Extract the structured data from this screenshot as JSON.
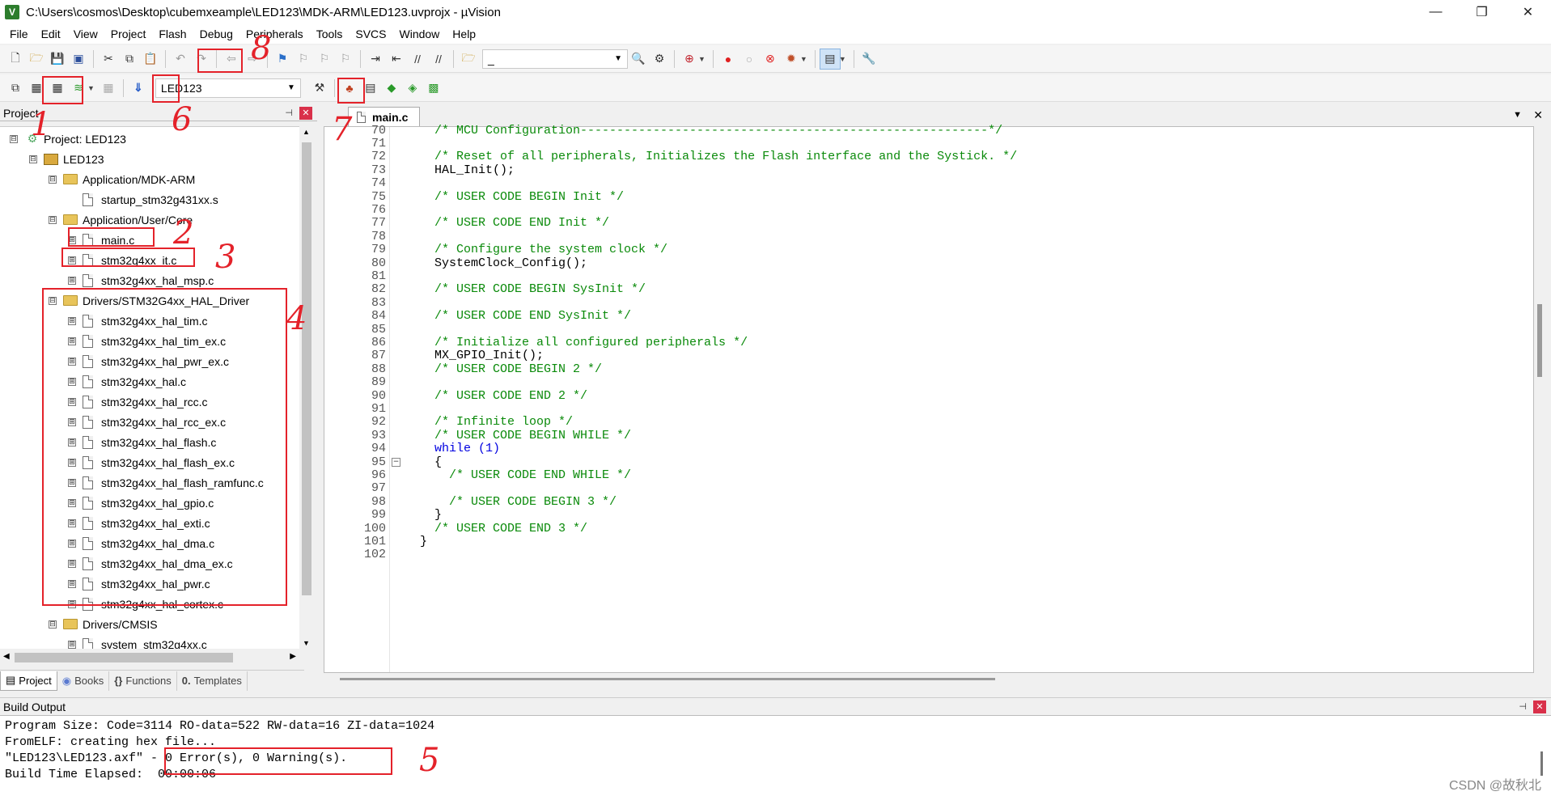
{
  "window": {
    "title": "C:\\Users\\cosmos\\Desktop\\cubemxeample\\LED123\\MDK-ARM\\LED123.uvprojx - µVision",
    "icon": "V",
    "controls": [
      "—",
      "❐",
      "✕"
    ]
  },
  "menu": [
    "File",
    "Edit",
    "View",
    "Project",
    "Flash",
    "Debug",
    "Peripherals",
    "Tools",
    "SVCS",
    "Window",
    "Help"
  ],
  "toolbar2": {
    "target": "LED123",
    "search_value": "_"
  },
  "project_panel": {
    "title": "Project",
    "tabs": [
      "Project",
      "Books",
      "Functions",
      "Templates"
    ],
    "tree": [
      {
        "label": "Project: LED123",
        "depth": 0,
        "type": "project",
        "exp": "⊟"
      },
      {
        "label": "LED123",
        "depth": 1,
        "type": "group",
        "exp": "⊟"
      },
      {
        "label": "Application/MDK-ARM",
        "depth": 2,
        "type": "folder",
        "exp": "⊟"
      },
      {
        "label": "startup_stm32g431xx.s",
        "depth": 3,
        "type": "file",
        "exp": ""
      },
      {
        "label": "Application/User/Core",
        "depth": 2,
        "type": "folder",
        "exp": "⊟"
      },
      {
        "label": "main.c",
        "depth": 3,
        "type": "file",
        "exp": "⊞"
      },
      {
        "label": "stm32g4xx_it.c",
        "depth": 3,
        "type": "file",
        "exp": "⊞"
      },
      {
        "label": "stm32g4xx_hal_msp.c",
        "depth": 3,
        "type": "file",
        "exp": "⊞"
      },
      {
        "label": "Drivers/STM32G4xx_HAL_Driver",
        "depth": 2,
        "type": "folder",
        "exp": "⊟"
      },
      {
        "label": "stm32g4xx_hal_tim.c",
        "depth": 3,
        "type": "file",
        "exp": "⊞"
      },
      {
        "label": "stm32g4xx_hal_tim_ex.c",
        "depth": 3,
        "type": "file",
        "exp": "⊞"
      },
      {
        "label": "stm32g4xx_hal_pwr_ex.c",
        "depth": 3,
        "type": "file",
        "exp": "⊞"
      },
      {
        "label": "stm32g4xx_hal.c",
        "depth": 3,
        "type": "file",
        "exp": "⊞"
      },
      {
        "label": "stm32g4xx_hal_rcc.c",
        "depth": 3,
        "type": "file",
        "exp": "⊞"
      },
      {
        "label": "stm32g4xx_hal_rcc_ex.c",
        "depth": 3,
        "type": "file",
        "exp": "⊞"
      },
      {
        "label": "stm32g4xx_hal_flash.c",
        "depth": 3,
        "type": "file",
        "exp": "⊞"
      },
      {
        "label": "stm32g4xx_hal_flash_ex.c",
        "depth": 3,
        "type": "file",
        "exp": "⊞"
      },
      {
        "label": "stm32g4xx_hal_flash_ramfunc.c",
        "depth": 3,
        "type": "file",
        "exp": "⊞"
      },
      {
        "label": "stm32g4xx_hal_gpio.c",
        "depth": 3,
        "type": "file",
        "exp": "⊞"
      },
      {
        "label": "stm32g4xx_hal_exti.c",
        "depth": 3,
        "type": "file",
        "exp": "⊞"
      },
      {
        "label": "stm32g4xx_hal_dma.c",
        "depth": 3,
        "type": "file",
        "exp": "⊞"
      },
      {
        "label": "stm32g4xx_hal_dma_ex.c",
        "depth": 3,
        "type": "file",
        "exp": "⊞"
      },
      {
        "label": "stm32g4xx_hal_pwr.c",
        "depth": 3,
        "type": "file",
        "exp": "⊞"
      },
      {
        "label": "stm32g4xx_hal_cortex.c",
        "depth": 3,
        "type": "file",
        "exp": "⊞"
      },
      {
        "label": "Drivers/CMSIS",
        "depth": 2,
        "type": "folder",
        "exp": "⊟"
      },
      {
        "label": "system_stm32g4xx.c",
        "depth": 3,
        "type": "file",
        "exp": "⊞"
      }
    ]
  },
  "editor": {
    "tab": "main.c",
    "lines": [
      {
        "n": "70",
        "t": "  /* MCU Configuration--------------------------------------------------------*/",
        "c": "cm"
      },
      {
        "n": "71",
        "t": "",
        "c": "pl"
      },
      {
        "n": "72",
        "t": "  /* Reset of all peripherals, Initializes the Flash interface and the Systick. */",
        "c": "cm"
      },
      {
        "n": "73",
        "t": "  HAL_Init();",
        "c": "pl"
      },
      {
        "n": "74",
        "t": "",
        "c": "pl"
      },
      {
        "n": "75",
        "t": "  /* USER CODE BEGIN Init */",
        "c": "cm"
      },
      {
        "n": "76",
        "t": "",
        "c": "pl"
      },
      {
        "n": "77",
        "t": "  /* USER CODE END Init */",
        "c": "cm"
      },
      {
        "n": "78",
        "t": "",
        "c": "pl"
      },
      {
        "n": "79",
        "t": "  /* Configure the system clock */",
        "c": "cm"
      },
      {
        "n": "80",
        "t": "  SystemClock_Config();",
        "c": "pl"
      },
      {
        "n": "81",
        "t": "",
        "c": "pl"
      },
      {
        "n": "82",
        "t": "  /* USER CODE BEGIN SysInit */",
        "c": "cm"
      },
      {
        "n": "83",
        "t": "",
        "c": "pl"
      },
      {
        "n": "84",
        "t": "  /* USER CODE END SysInit */",
        "c": "cm"
      },
      {
        "n": "85",
        "t": "",
        "c": "pl"
      },
      {
        "n": "86",
        "t": "  /* Initialize all configured peripherals */",
        "c": "cm"
      },
      {
        "n": "87",
        "t": "  MX_GPIO_Init();",
        "c": "pl"
      },
      {
        "n": "88",
        "t": "  /* USER CODE BEGIN 2 */",
        "c": "cm"
      },
      {
        "n": "89",
        "t": "",
        "c": "pl"
      },
      {
        "n": "90",
        "t": "  /* USER CODE END 2 */",
        "c": "cm"
      },
      {
        "n": "91",
        "t": "",
        "c": "pl"
      },
      {
        "n": "92",
        "t": "  /* Infinite loop */",
        "c": "cm"
      },
      {
        "n": "93",
        "t": "  /* USER CODE BEGIN WHILE */",
        "c": "cm"
      },
      {
        "n": "94",
        "t": "  while (1)",
        "c": "kw"
      },
      {
        "n": "95",
        "t": "  {",
        "c": "pl"
      },
      {
        "n": "96",
        "t": "    /* USER CODE END WHILE */",
        "c": "cm"
      },
      {
        "n": "97",
        "t": "",
        "c": "pl"
      },
      {
        "n": "98",
        "t": "    /* USER CODE BEGIN 3 */",
        "c": "cm"
      },
      {
        "n": "99",
        "t": "  }",
        "c": "pl"
      },
      {
        "n": "100",
        "t": "  /* USER CODE END 3 */",
        "c": "cm"
      },
      {
        "n": "101",
        "t": "}",
        "c": "pl"
      },
      {
        "n": "102",
        "t": "",
        "c": "pl"
      }
    ]
  },
  "build_output": {
    "title": "Build Output",
    "lines": [
      "Program Size: Code=3114 RO-data=522 RW-data=16 ZI-data=1024",
      "FromELF: creating hex file...",
      "\"LED123\\LED123.axf\" - 0 Error(s), 0 Warning(s).",
      "Build Time Elapsed:  00:00:06"
    ]
  },
  "annotations": [
    "1",
    "2",
    "3",
    "4",
    "5",
    "6",
    "7",
    "8"
  ],
  "watermark": "CSDN @故秋北",
  "colors": {
    "annotation": "#e4222a",
    "comment": "#0a8a0a",
    "keyword": "#0000e0"
  }
}
